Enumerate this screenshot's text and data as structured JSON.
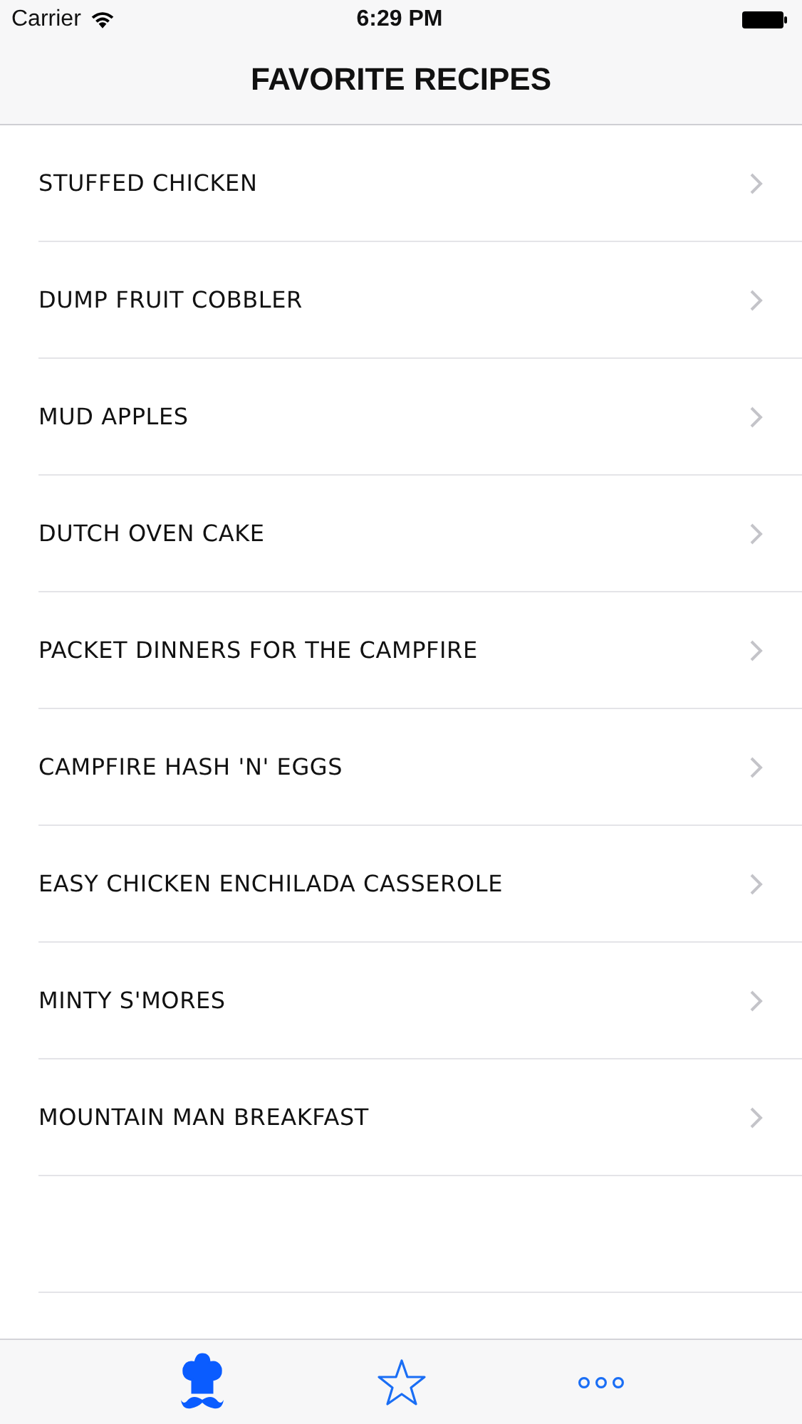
{
  "status_bar": {
    "carrier": "Carrier",
    "time": "6:29 PM"
  },
  "nav_bar": {
    "title": "FAVORITE RECIPES"
  },
  "recipes": [
    {
      "name": "STUFFED CHICKEN"
    },
    {
      "name": "DUMP FRUIT COBBLER"
    },
    {
      "name": "MUD APPLES"
    },
    {
      "name": "DUTCH OVEN CAKE"
    },
    {
      "name": "PACKET DINNERS FOR THE CAMPFIRE"
    },
    {
      "name": "CAMPFIRE HASH 'N' EGGS"
    },
    {
      "name": "EASY CHICKEN ENCHILADA CASSEROLE"
    },
    {
      "name": "MINTY S'MORES"
    },
    {
      "name": "MOUNTAIN MAN BREAKFAST"
    }
  ],
  "tab_bar": [
    {
      "kind": "chef",
      "selected": true
    },
    {
      "kind": "star",
      "selected": false
    },
    {
      "kind": "more",
      "selected": false
    }
  ]
}
